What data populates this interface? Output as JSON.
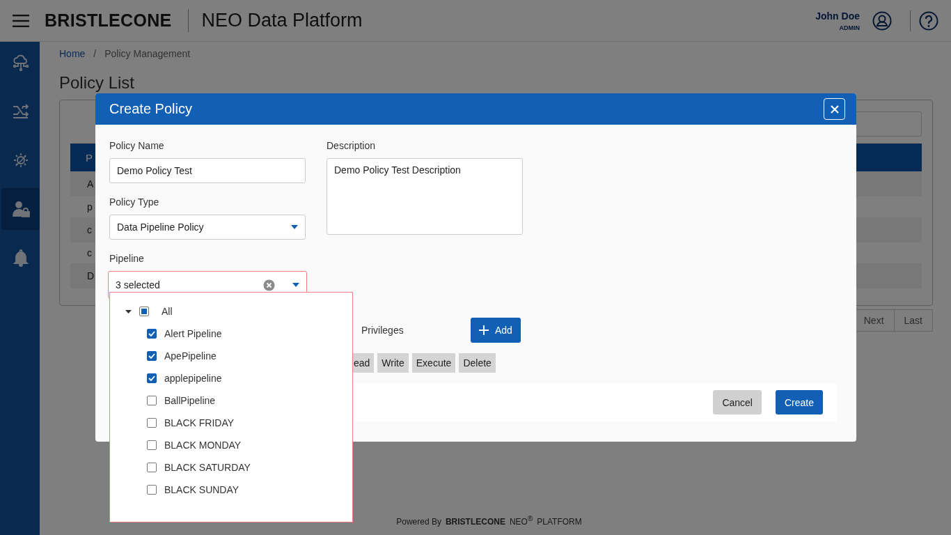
{
  "header": {
    "brand": "BRISTLECONE",
    "product": "NEO Data Platform",
    "user": {
      "name": "John Doe",
      "role": "ADMIN"
    }
  },
  "sidebar": {
    "items": [
      {
        "selected": false
      },
      {
        "selected": false
      },
      {
        "selected": false
      },
      {
        "selected": true
      },
      {
        "selected": false
      }
    ]
  },
  "breadcrumb": {
    "separator": "/",
    "items": [
      {
        "label": "Home",
        "link": true
      },
      {
        "label": "Policy Management",
        "link": false
      }
    ]
  },
  "page_title": "Policy List",
  "table": {
    "column_1": "P",
    "rows": [
      "A",
      "p",
      "c",
      "c",
      "D"
    ]
  },
  "pagination": [
    "Next",
    "Last"
  ],
  "dialog": {
    "title": "Create Policy",
    "policy_name": {
      "label": "Policy Name",
      "value": "Demo Policy Test"
    },
    "policy_type": {
      "label": "Policy Type",
      "value": "Data Pipeline Policy"
    },
    "pipeline": {
      "label": "Pipeline",
      "value": "3 selected",
      "highlighted": true,
      "tree": {
        "label": "All",
        "expanded": true,
        "checked": false,
        "indeterminate": true,
        "children": [
          {
            "label": "Alert Pipeline",
            "checked": true
          },
          {
            "label": "ApePipeline",
            "checked": true
          },
          {
            "label": "applepipeline",
            "checked": true
          },
          {
            "label": "BallPipeline",
            "checked": false
          },
          {
            "label": "BLACK FRIDAY",
            "checked": false
          },
          {
            "label": "BLACK MONDAY",
            "checked": false
          },
          {
            "label": "BLACK SATURDAY",
            "checked": false
          },
          {
            "label": "BLACK SUNDAY",
            "checked": false
          }
        ]
      }
    },
    "description": {
      "label": "Description",
      "value": "Demo Policy Test Description"
    },
    "privileges": {
      "label": "Privileges",
      "add_button": "Add",
      "chips": [
        "ead",
        "Write",
        "Execute",
        "Delete"
      ]
    },
    "buttons": [
      {
        "label": "Cancel",
        "kind": "secondary"
      },
      {
        "label": "Create",
        "kind": "primary"
      }
    ]
  },
  "footer": {
    "powered_by": "Powered By",
    "brand": "BRISTLECONE",
    "product": "NEO$^{®}$",
    "platform": "PLATFORM"
  }
}
